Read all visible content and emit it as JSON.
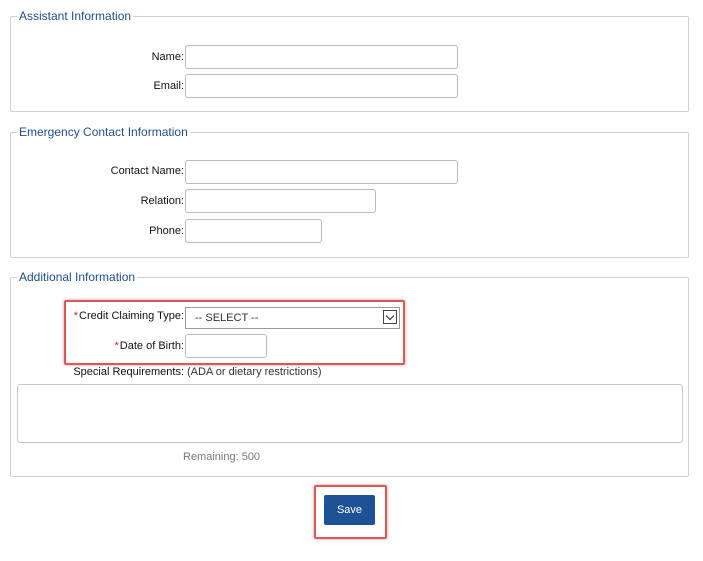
{
  "assistant": {
    "legend": "Assistant Information",
    "name_label": "Name:",
    "email_label": "Email:"
  },
  "emergency": {
    "legend": "Emergency Contact Information",
    "contact_label": "Contact Name:",
    "relation_label": "Relation:",
    "phone_label": "Phone:"
  },
  "additional": {
    "legend": "Additional Information",
    "required_mark": "*",
    "credit_label": "Credit Claiming Type:",
    "credit_selected": "-- SELECT --",
    "dob_label": "Date of Birth:",
    "special_label": "Special Requirements:",
    "special_hint": "(ADA or dietary restrictions)",
    "remaining": "Remaining: 500"
  },
  "actions": {
    "save_label": "Save"
  },
  "colors": {
    "legend": "#1f4e8c",
    "required": "#c0272d",
    "button": "#1d5296",
    "highlight": "#e05656"
  }
}
